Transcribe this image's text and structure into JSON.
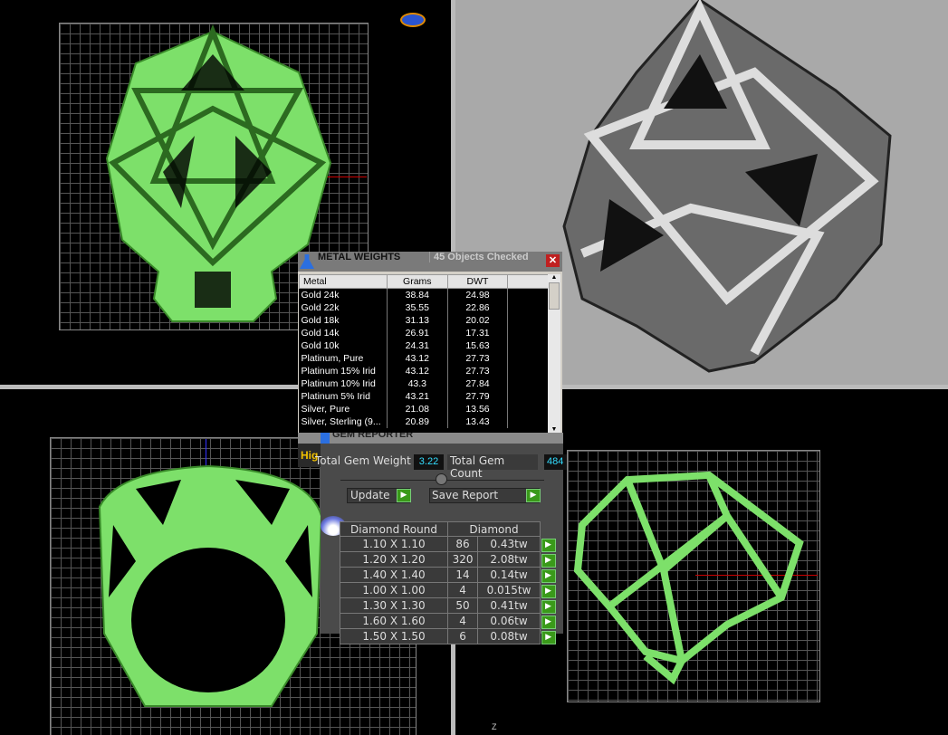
{
  "metal_weights": {
    "title": "METAL WEIGHTS",
    "status": "45 Objects Checked",
    "columns": [
      "Metal",
      "Grams",
      "DWT",
      ""
    ],
    "rows": [
      [
        "Gold 24k",
        "38.84",
        "24.98"
      ],
      [
        "Gold 22k",
        "35.55",
        "22.86"
      ],
      [
        "Gold 18k",
        "31.13",
        "20.02"
      ],
      [
        "Gold 14k",
        "26.91",
        "17.31"
      ],
      [
        "Gold 10k",
        "24.31",
        "15.63"
      ],
      [
        "Platinum, Pure",
        "43.12",
        "27.73"
      ],
      [
        "Platinum 15% Irid",
        "43.12",
        "27.73"
      ],
      [
        "Platinum 10% Irid",
        "43.3",
        "27.84"
      ],
      [
        "Platinum 5% Irid",
        "43.21",
        "27.79"
      ],
      [
        "Silver, Pure",
        "21.08",
        "13.56"
      ],
      [
        "Silver, Sterling (9...",
        "20.89",
        "13.43"
      ]
    ]
  },
  "gem_reporter": {
    "title": "GEM REPORTER",
    "highlight_label": "Hig",
    "total_weight_label": "Total Gem Weight",
    "total_weight": "3.22",
    "total_count_label": "Total Gem Count",
    "total_count": "484",
    "update_label": "Update",
    "save_label": "Save Report",
    "col_shape": "Diamond Round",
    "col_type": "Diamond",
    "rows": [
      [
        "1.10 X 1.10",
        "86",
        "0.43tw"
      ],
      [
        "1.20 X 1.20",
        "320",
        "2.08tw"
      ],
      [
        "1.40 X 1.40",
        "14",
        "0.14tw"
      ],
      [
        "1.00 X 1.00",
        "4",
        "0.015tw"
      ],
      [
        "1.30 X 1.30",
        "50",
        "0.41tw"
      ],
      [
        "1.60 X 1.60",
        "4",
        "0.06tw"
      ],
      [
        "1.50 X 1.50",
        "6",
        "0.08tw"
      ]
    ]
  },
  "viewport_axis_label": "Z",
  "colors": {
    "model_green": "#7de06a",
    "viewport_bg": "#000000",
    "render_bg": "#a9a9a9",
    "accent_yellow": "#f0c000",
    "value_cyan": "#33ddff"
  }
}
